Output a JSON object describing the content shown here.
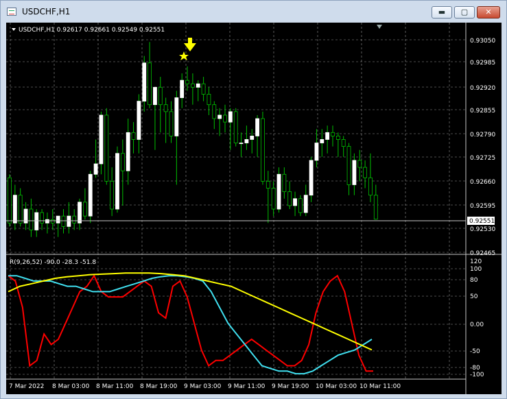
{
  "window": {
    "title": "USDCHF,H1",
    "buttons": {
      "minimize": "▬",
      "maximize": "▢",
      "close": "✕"
    }
  },
  "chart": {
    "header": "USDCHF,H1  0.92617 0.92661 0.92549 0.92551",
    "price_ticks": [
      "0.93050",
      "0.92985",
      "0.92920",
      "0.92855",
      "0.92790",
      "0.92725",
      "0.92660",
      "0.92595",
      "0.92530",
      "0.92465"
    ],
    "current_price": "0.92551",
    "indicator_header": "R(9,26,52) -90.0 -28.3 -51.8",
    "indicator_ticks": [
      "120",
      "100",
      "80",
      "50",
      "0.00",
      "-50",
      "-80",
      "-100"
    ],
    "time_labels": [
      "7 Mar 2022",
      "8 Mar 03:00",
      "8 Mar 11:00",
      "8 Mar 19:00",
      "9 Mar 03:00",
      "9 Mar 11:00",
      "9 Mar 19:00",
      "10 Mar 03:00",
      "10 Mar 11:00"
    ],
    "colors": {
      "background": "#000000",
      "bull_candle": "#ffffff",
      "wick": "#00c000",
      "grid": "#c8c8c8",
      "red_line": "#ff0000",
      "cyan_line": "#40e0f0",
      "yellow_line": "#ffff00",
      "arrow": "#ffff00"
    },
    "icons": {
      "arrow": "down-arrow-icon",
      "star": "star-icon",
      "triangle": "triangle-down-icon"
    }
  },
  "chart_data": [
    {
      "type": "candlestick",
      "title": "USDCHF,H1",
      "ylim": [
        0.9245,
        0.931
      ],
      "candles": [
        {
          "o": 0.9267,
          "h": 0.9268,
          "l": 0.9253,
          "c": 0.9254
        },
        {
          "o": 0.9254,
          "h": 0.9265,
          "l": 0.9252,
          "c": 0.9262
        },
        {
          "o": 0.9262,
          "h": 0.9264,
          "l": 0.9253,
          "c": 0.9254
        },
        {
          "o": 0.9254,
          "h": 0.926,
          "l": 0.9252,
          "c": 0.9258
        },
        {
          "o": 0.9258,
          "h": 0.9261,
          "l": 0.925,
          "c": 0.9252
        },
        {
          "o": 0.9252,
          "h": 0.9258,
          "l": 0.925,
          "c": 0.9257
        },
        {
          "o": 0.9257,
          "h": 0.9258,
          "l": 0.9252,
          "c": 0.9254
        },
        {
          "o": 0.9254,
          "h": 0.9257,
          "l": 0.9251,
          "c": 0.9255
        },
        {
          "o": 0.9255,
          "h": 0.9258,
          "l": 0.9252,
          "c": 0.9254
        },
        {
          "o": 0.9254,
          "h": 0.9256,
          "l": 0.925,
          "c": 0.9256
        },
        {
          "o": 0.9256,
          "h": 0.9258,
          "l": 0.9251,
          "c": 0.9253
        },
        {
          "o": 0.9253,
          "h": 0.926,
          "l": 0.9251,
          "c": 0.9256
        },
        {
          "o": 0.9256,
          "h": 0.9258,
          "l": 0.9252,
          "c": 0.9254
        },
        {
          "o": 0.9254,
          "h": 0.9261,
          "l": 0.9252,
          "c": 0.926
        },
        {
          "o": 0.926,
          "h": 0.9264,
          "l": 0.9255,
          "c": 0.9256
        },
        {
          "o": 0.9256,
          "h": 0.9269,
          "l": 0.9254,
          "c": 0.9268
        },
        {
          "o": 0.9268,
          "h": 0.9278,
          "l": 0.9267,
          "c": 0.9271
        },
        {
          "o": 0.9271,
          "h": 0.9286,
          "l": 0.9268,
          "c": 0.9285
        },
        {
          "o": 0.9285,
          "h": 0.9287,
          "l": 0.9265,
          "c": 0.9266
        },
        {
          "o": 0.9266,
          "h": 0.927,
          "l": 0.9256,
          "c": 0.9258
        },
        {
          "o": 0.9258,
          "h": 0.9276,
          "l": 0.9257,
          "c": 0.9274
        },
        {
          "o": 0.9274,
          "h": 0.9278,
          "l": 0.9259,
          "c": 0.9269
        },
        {
          "o": 0.9269,
          "h": 0.9284,
          "l": 0.9265,
          "c": 0.928
        },
        {
          "o": 0.928,
          "h": 0.9283,
          "l": 0.9274,
          "c": 0.9278
        },
        {
          "o": 0.9278,
          "h": 0.9291,
          "l": 0.9274,
          "c": 0.9289
        },
        {
          "o": 0.9289,
          "h": 0.9302,
          "l": 0.9286,
          "c": 0.93
        },
        {
          "o": 0.93,
          "h": 0.9306,
          "l": 0.9287,
          "c": 0.9288
        },
        {
          "o": 0.9288,
          "h": 0.9293,
          "l": 0.9275,
          "c": 0.9293
        },
        {
          "o": 0.9293,
          "h": 0.9296,
          "l": 0.928,
          "c": 0.9288
        },
        {
          "o": 0.9288,
          "h": 0.929,
          "l": 0.9277,
          "c": 0.9286
        },
        {
          "o": 0.9286,
          "h": 0.9289,
          "l": 0.9277,
          "c": 0.9279
        },
        {
          "o": 0.9279,
          "h": 0.9292,
          "l": 0.9265,
          "c": 0.929
        },
        {
          "o": 0.929,
          "h": 0.9297,
          "l": 0.9287,
          "c": 0.9295
        },
        {
          "o": 0.9295,
          "h": 0.9299,
          "l": 0.9292,
          "c": 0.9294
        },
        {
          "o": 0.9294,
          "h": 0.9297,
          "l": 0.9288,
          "c": 0.9293
        },
        {
          "o": 0.9293,
          "h": 0.9295,
          "l": 0.9289,
          "c": 0.9294
        },
        {
          "o": 0.9294,
          "h": 0.9296,
          "l": 0.9289,
          "c": 0.9291
        },
        {
          "o": 0.9291,
          "h": 0.9293,
          "l": 0.9285,
          "c": 0.9288
        },
        {
          "o": 0.9288,
          "h": 0.9289,
          "l": 0.9281,
          "c": 0.9284
        },
        {
          "o": 0.9284,
          "h": 0.9287,
          "l": 0.9279,
          "c": 0.9285
        },
        {
          "o": 0.9285,
          "h": 0.9288,
          "l": 0.928,
          "c": 0.9283
        },
        {
          "o": 0.9283,
          "h": 0.9287,
          "l": 0.9275,
          "c": 0.9286
        },
        {
          "o": 0.9286,
          "h": 0.9287,
          "l": 0.9276,
          "c": 0.9277
        },
        {
          "o": 0.9277,
          "h": 0.928,
          "l": 0.9273,
          "c": 0.9277
        },
        {
          "o": 0.9277,
          "h": 0.9282,
          "l": 0.9275,
          "c": 0.9278
        },
        {
          "o": 0.9278,
          "h": 0.9281,
          "l": 0.9274,
          "c": 0.9279
        },
        {
          "o": 0.9279,
          "h": 0.9285,
          "l": 0.9273,
          "c": 0.9284
        },
        {
          "o": 0.9284,
          "h": 0.9286,
          "l": 0.9265,
          "c": 0.9266
        },
        {
          "o": 0.9266,
          "h": 0.9269,
          "l": 0.9254,
          "c": 0.9264
        },
        {
          "o": 0.9264,
          "h": 0.9266,
          "l": 0.9256,
          "c": 0.9258
        },
        {
          "o": 0.9258,
          "h": 0.927,
          "l": 0.9257,
          "c": 0.9268
        },
        {
          "o": 0.9268,
          "h": 0.927,
          "l": 0.9261,
          "c": 0.9263
        },
        {
          "o": 0.9263,
          "h": 0.9266,
          "l": 0.9258,
          "c": 0.9259
        },
        {
          "o": 0.9259,
          "h": 0.9263,
          "l": 0.9256,
          "c": 0.9261
        },
        {
          "o": 0.9261,
          "h": 0.9262,
          "l": 0.9256,
          "c": 0.9257
        },
        {
          "o": 0.9257,
          "h": 0.9265,
          "l": 0.9256,
          "c": 0.9262
        },
        {
          "o": 0.9262,
          "h": 0.9273,
          "l": 0.926,
          "c": 0.9272
        },
        {
          "o": 0.9272,
          "h": 0.9281,
          "l": 0.927,
          "c": 0.9277
        },
        {
          "o": 0.9277,
          "h": 0.9281,
          "l": 0.9273,
          "c": 0.9278
        },
        {
          "o": 0.9278,
          "h": 0.9282,
          "l": 0.9274,
          "c": 0.928
        },
        {
          "o": 0.928,
          "h": 0.9282,
          "l": 0.9276,
          "c": 0.9279
        },
        {
          "o": 0.9279,
          "h": 0.928,
          "l": 0.9273,
          "c": 0.9278
        },
        {
          "o": 0.9278,
          "h": 0.9279,
          "l": 0.9273,
          "c": 0.9276
        },
        {
          "o": 0.9276,
          "h": 0.9277,
          "l": 0.9262,
          "c": 0.9265
        },
        {
          "o": 0.9265,
          "h": 0.9274,
          "l": 0.9262,
          "c": 0.9272
        },
        {
          "o": 0.9272,
          "h": 0.9275,
          "l": 0.9266,
          "c": 0.927
        },
        {
          "o": 0.927,
          "h": 0.9272,
          "l": 0.9264,
          "c": 0.9267
        },
        {
          "o": 0.9267,
          "h": 0.9274,
          "l": 0.926,
          "c": 0.9262
        },
        {
          "o": 0.9262,
          "h": 0.9265,
          "l": 0.9255,
          "c": 0.92551
        }
      ]
    },
    {
      "type": "line",
      "title": "R(9,26,52) -90.0 -28.3 -51.8",
      "ylim": [
        -100,
        120
      ],
      "series": [
        {
          "color": "#ff0000",
          "values": [
            90,
            80,
            30,
            -80,
            -70,
            -20,
            -40,
            -30,
            0,
            30,
            60,
            70,
            90,
            60,
            50,
            50,
            50,
            60,
            70,
            80,
            70,
            20,
            10,
            70,
            80,
            50,
            0,
            -50,
            -80,
            -70,
            -70,
            -60,
            -50,
            -40,
            -30,
            -40,
            -50,
            -60,
            -70,
            -80,
            -80,
            -70,
            -40,
            20,
            60,
            80,
            90,
            60,
            0,
            -60,
            -90,
            -90
          ]
        },
        {
          "color": "#40e0f0",
          "values": [
            90,
            90,
            85,
            80,
            80,
            80,
            75,
            70,
            70,
            65,
            60,
            60,
            60,
            65,
            70,
            75,
            80,
            85,
            88,
            90,
            90,
            88,
            85,
            80,
            60,
            30,
            0,
            -20,
            -40,
            -60,
            -80,
            -85,
            -90,
            -90,
            -95,
            -95,
            -90,
            -80,
            -70,
            -60,
            -55,
            -50,
            -40,
            -30
          ]
        },
        {
          "color": "#ffff00",
          "values": [
            60,
            70,
            75,
            80,
            85,
            88,
            90,
            92,
            93,
            94,
            95,
            95,
            95,
            94,
            92,
            90,
            85,
            80,
            75,
            70,
            60,
            50,
            40,
            30,
            20,
            10,
            0,
            -10,
            -20,
            -30,
            -40,
            -50
          ]
        }
      ]
    }
  ]
}
